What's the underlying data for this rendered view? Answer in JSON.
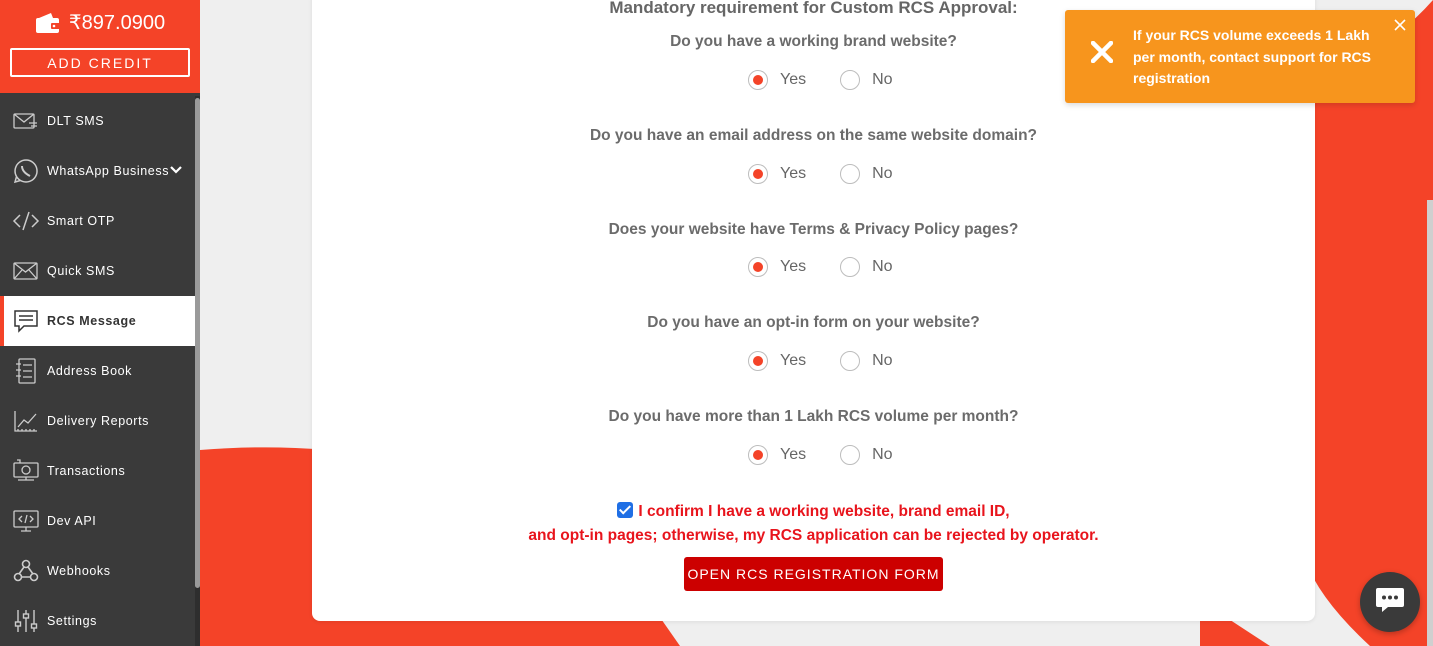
{
  "wallet": {
    "balance": "₹897.0900",
    "add_credit_label": "ADD CREDIT"
  },
  "sidebar": {
    "items": [
      {
        "label": "DLT SMS",
        "icon": "envelope-icon"
      },
      {
        "label": "WhatsApp Business",
        "icon": "whatsapp-icon",
        "has_submenu": true
      },
      {
        "label": "Smart OTP",
        "icon": "code-icon"
      },
      {
        "label": "Quick SMS",
        "icon": "mail-open-icon"
      },
      {
        "label": "RCS Message",
        "icon": "chat-bubble-icon",
        "active": true
      },
      {
        "label": "Address Book",
        "icon": "address-book-icon"
      },
      {
        "label": "Delivery Reports",
        "icon": "chart-icon"
      },
      {
        "label": "Transactions",
        "icon": "transactions-icon"
      },
      {
        "label": "Dev API",
        "icon": "monitor-code-icon"
      },
      {
        "label": "Webhooks",
        "icon": "webhook-icon"
      },
      {
        "label": "Settings",
        "icon": "sliders-icon"
      }
    ]
  },
  "form": {
    "title": "Mandatory requirement for Custom RCS Approval:",
    "questions": [
      {
        "text": "Do you have a working brand website?",
        "selected": "Yes"
      },
      {
        "text": "Do you have an email address on the same website domain?",
        "selected": "Yes"
      },
      {
        "text": "Does your website have Terms & Privacy Policy pages?",
        "selected": "Yes"
      },
      {
        "text": "Do you have an opt-in form on your website?",
        "selected": "Yes"
      },
      {
        "text": "Do you have more than 1 Lakh RCS volume per month?",
        "selected": "Yes"
      }
    ],
    "option_yes": "Yes",
    "option_no": "No",
    "confirm_line1": "I confirm I have a working website, brand email ID,",
    "confirm_line2": "and opt-in pages; otherwise, my RCS application can be rejected by operator.",
    "confirm_checked": true,
    "submit_label": "OPEN RCS REGISTRATION FORM"
  },
  "toast": {
    "message": "If your RCS volume exceeds 1 Lakh per month, contact support for RCS registration",
    "color": "#f7951d"
  },
  "colors": {
    "accent": "#f44328",
    "sidebar": "#3a3a3a",
    "danger": "#cc0000"
  }
}
